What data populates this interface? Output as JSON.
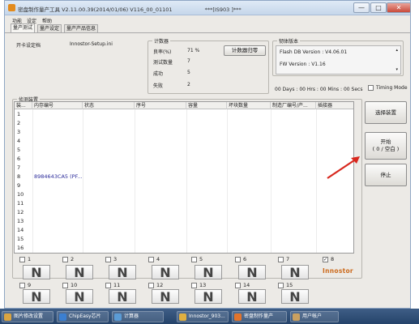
{
  "window": {
    "title": "密盘制作量产工具 V2.11.00.39(2014/01/06)   V116_00_01101",
    "title_tag": "***[IS903 ]***",
    "min_label": "—",
    "max_label": "□",
    "close_label": "✕"
  },
  "menu": [
    "功能",
    "设定",
    "帮助"
  ],
  "tabs": [
    "量产测试",
    "量产设定",
    "量产产品信息"
  ],
  "setting_file": {
    "label": "开卡设定档",
    "value": "Innostor-Setup.ini"
  },
  "counter": {
    "group_title": "计数器",
    "rows": [
      {
        "label": "良率(%)",
        "value": "71 %"
      },
      {
        "label": "测试数量",
        "value": "7"
      },
      {
        "label": "成功",
        "value": "5"
      },
      {
        "label": "失败",
        "value": "2"
      }
    ],
    "reset_button": "计数器归零"
  },
  "firmware": {
    "group_title": "韧体版本",
    "flash_db": "Flash DB Version :  V4.06.01",
    "fw": "FW Version :   V1.16"
  },
  "timer": "00 Days : 00 Hrs : 00 Mins : 00 Secs",
  "timing_mode": {
    "label": "Timing Mode",
    "checked": false
  },
  "devices": {
    "group_title": "侦测装置",
    "columns": [
      "装...",
      "内存编号",
      "状态",
      "序号",
      "容量",
      "坏块数量",
      "制造厂编号/产...",
      "插接器"
    ],
    "rows": [
      {
        "num": "1",
        "mem": ""
      },
      {
        "num": "2",
        "mem": ""
      },
      {
        "num": "3",
        "mem": ""
      },
      {
        "num": "4",
        "mem": ""
      },
      {
        "num": "5",
        "mem": ""
      },
      {
        "num": "6",
        "mem": ""
      },
      {
        "num": "7",
        "mem": ""
      },
      {
        "num": "8",
        "mem": "8984643CA5 (PF..."
      },
      {
        "num": "9",
        "mem": ""
      },
      {
        "num": "10",
        "mem": ""
      },
      {
        "num": "11",
        "mem": ""
      },
      {
        "num": "12",
        "mem": ""
      },
      {
        "num": "13",
        "mem": ""
      },
      {
        "num": "14",
        "mem": ""
      },
      {
        "num": "15",
        "mem": ""
      },
      {
        "num": "16",
        "mem": ""
      }
    ]
  },
  "side_buttons": {
    "select_device": "选择装置",
    "start": "开始",
    "start_sub": "( 0 / 空白 )",
    "stop": "停止"
  },
  "ports": {
    "row1": [
      {
        "num": "1",
        "checked": false,
        "glyph": "N"
      },
      {
        "num": "2",
        "checked": false,
        "glyph": "N"
      },
      {
        "num": "3",
        "checked": false,
        "glyph": "N"
      },
      {
        "num": "4",
        "checked": false,
        "glyph": "N"
      },
      {
        "num": "5",
        "checked": false,
        "glyph": "N"
      },
      {
        "num": "6",
        "checked": false,
        "glyph": "N"
      },
      {
        "num": "7",
        "checked": false,
        "glyph": "N"
      },
      {
        "num": "8",
        "checked": true,
        "glyph": ""
      }
    ],
    "row2": [
      {
        "num": "9",
        "checked": false,
        "glyph": "N"
      },
      {
        "num": "10",
        "checked": false,
        "glyph": "N"
      },
      {
        "num": "11",
        "checked": false,
        "glyph": "N"
      },
      {
        "num": "12",
        "checked": false,
        "glyph": "N"
      },
      {
        "num": "13",
        "checked": false,
        "glyph": "N"
      },
      {
        "num": "14",
        "checked": false,
        "glyph": "N"
      },
      {
        "num": "15",
        "checked": false,
        "glyph": "N"
      }
    ],
    "check_mark": "✓"
  },
  "brand_logo": "Innostor",
  "taskbar": [
    {
      "label": "图片修改设置",
      "color": "#d9a441"
    },
    {
      "label": "ChipEasy芯片",
      "color": "#3c7fd0"
    },
    {
      "label": "计算器",
      "color": "#5b9bd5"
    },
    {
      "label": "Innostor_903...",
      "color": "#e0b040"
    },
    {
      "label": "密盘制作量产",
      "color": "#e2742c"
    },
    {
      "label": "用户帐户",
      "color": "#c9a060"
    }
  ],
  "accent_arrow_color": "#d8281e"
}
